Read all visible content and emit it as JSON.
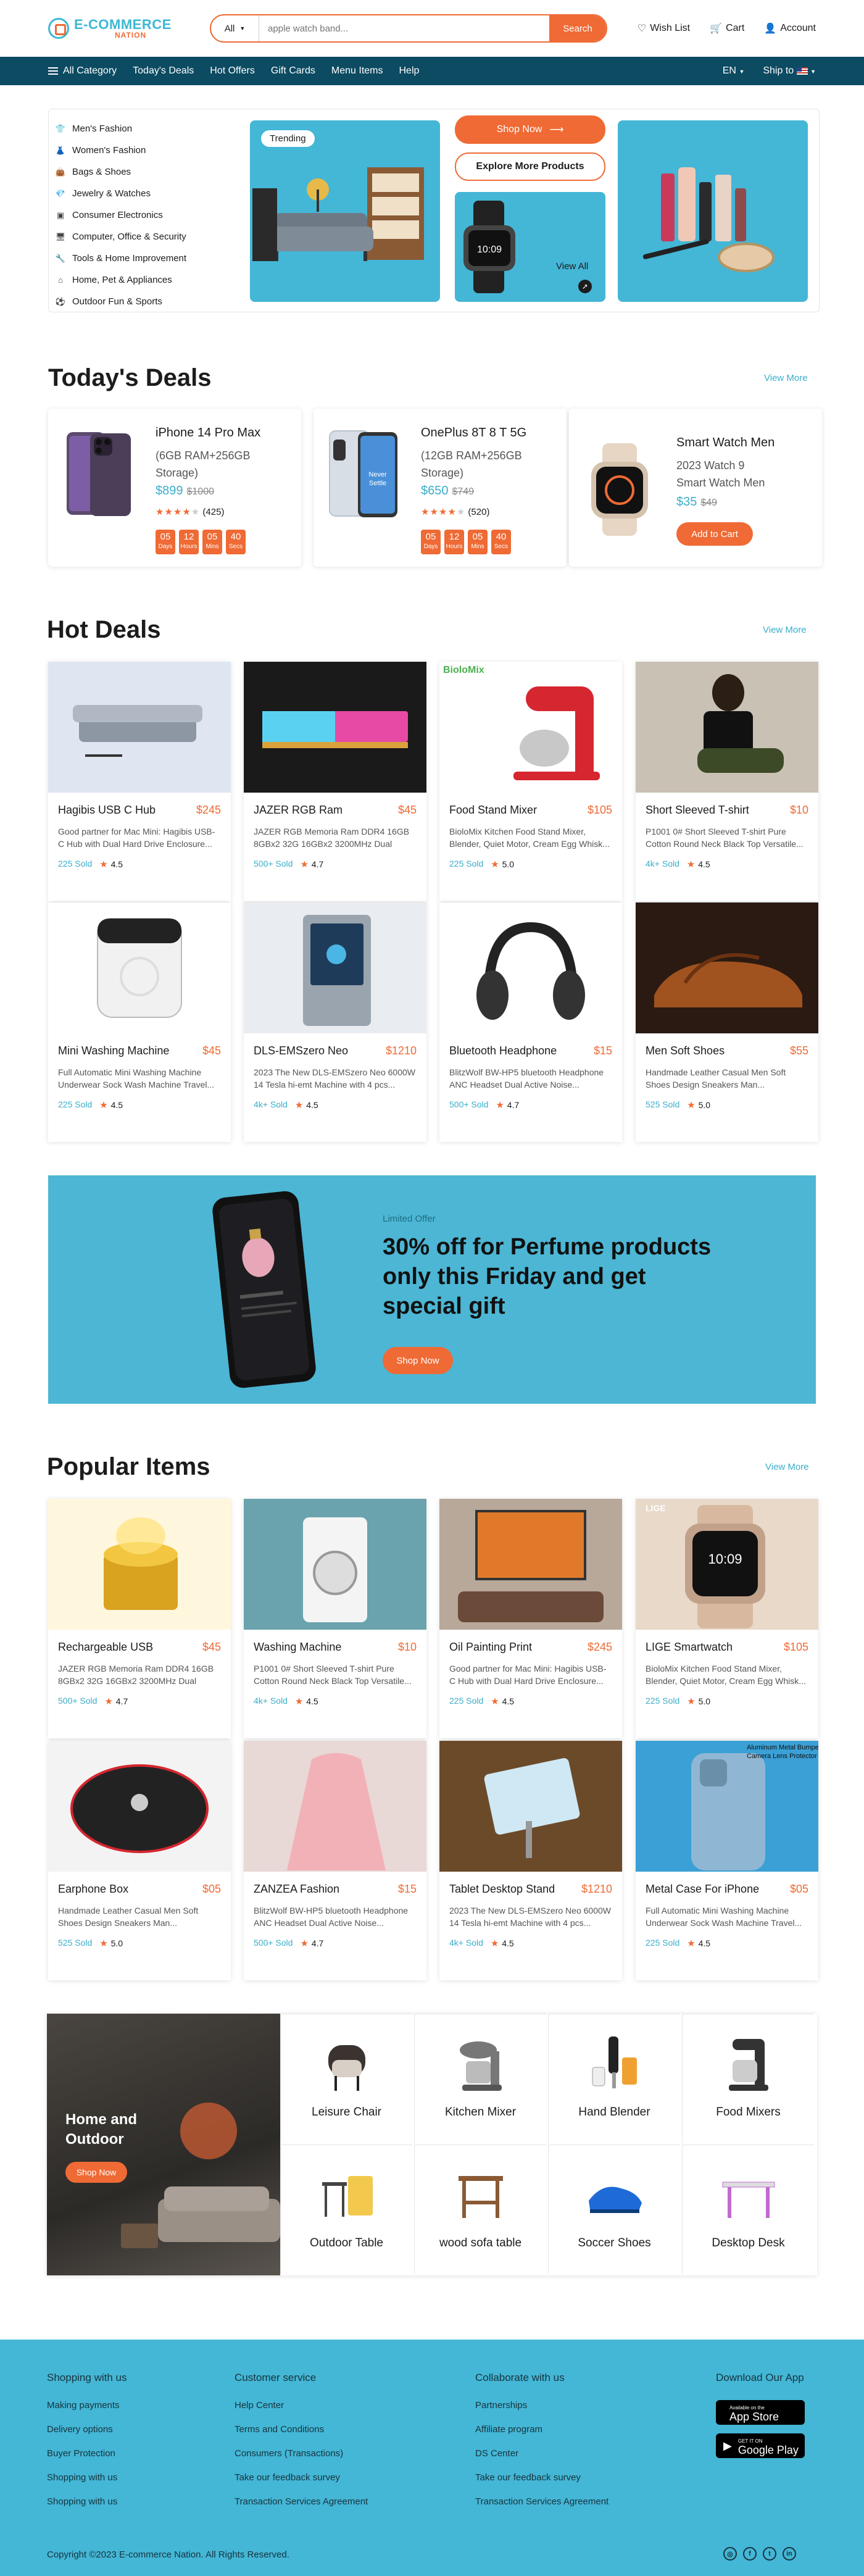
{
  "brand": {
    "line1": "E-COMMERCE",
    "line2": "NATION"
  },
  "search": {
    "category": "All",
    "placeholder": "apple watch band...",
    "button": "Search"
  },
  "header_links": [
    "Wish List",
    "Cart",
    "Account"
  ],
  "nav": {
    "all_category": "All Category",
    "items": [
      "Today's Deals",
      "Hot Offers",
      "Gift Cards",
      "Menu Items",
      "Help"
    ],
    "language": "EN",
    "ship_to": "Ship to"
  },
  "sidebar": {
    "items": [
      "Men's Fashion",
      "Women's Fashion",
      "Bags & Shoes",
      "Jewelry & Watches",
      "Consumer Electronics",
      "Computer, Office & Security",
      "Tools & Home Improvement",
      "Home, Pet & Appliances",
      "Outdoor Fun & Sports"
    ]
  },
  "hero": {
    "trending": "Trending",
    "shop_now": "Shop Now",
    "explore": "Explore More Products",
    "view_all": "View All"
  },
  "todays_deals": {
    "title": "Today's Deals",
    "view_more": "View More",
    "items": [
      {
        "name": "iPhone 14 Pro Max",
        "spec1": "(6GB RAM+256GB",
        "spec2": "Storage)",
        "price": "$899",
        "old": "$1000",
        "reviews": "(425)",
        "timer": [
          "05",
          "12",
          "05",
          "40"
        ]
      },
      {
        "name": "OnePlus 8T 8 T 5G",
        "spec1": "(12GB RAM+256GB",
        "spec2": "Storage)",
        "price": "$650",
        "old": "$749",
        "reviews": "(520)",
        "timer": [
          "05",
          "12",
          "05",
          "40"
        ]
      },
      {
        "name": "Smart Watch Men",
        "spec1": "2023 Watch 9",
        "spec2": "Smart Watch Men",
        "price": "$35",
        "old": "$49",
        "button": "Add to Cart"
      }
    ],
    "timer_labels": [
      "Days",
      "Hours",
      "Mins",
      "Secs"
    ],
    "rating": 4
  },
  "hot_deals": {
    "title": "Hot Deals",
    "view_more": "View More",
    "items": [
      {
        "name": "Hagibis USB C Hub",
        "price": "$245",
        "desc": "Good partner for Mac Mini: Hagibis USB-C Hub with Dual Hard Drive Enclosure...",
        "sold": "225 Sold",
        "rating": "4.5"
      },
      {
        "name": "JAZER RGB Ram",
        "price": "$45",
        "desc": "JAZER RGB Memoria Ram DDR4 16GB 8GBx2 32G 16GBx2 3200MHz Dual Cha...",
        "sold": "500+ Sold",
        "rating": "4.7"
      },
      {
        "name": "Food Stand Mixer",
        "price": "$105",
        "desc": "BioloMix Kitchen Food Stand Mixer, Blender, Quiet Motor, Cream Egg Whisk...",
        "sold": "225 Sold",
        "rating": "5.0"
      },
      {
        "name": "Short Sleeved T-shirt",
        "price": "$10",
        "desc": "P1001 0# Short Sleeved T-shirt Pure Cotton Round Neck Black Top Versatile...",
        "sold": "4k+ Sold",
        "rating": "4.5"
      },
      {
        "name": "Mini Washing Machine",
        "price": "$45",
        "desc": "Full Automatic Mini Washing Machine Underwear Sock Wash Machine Travel...",
        "sold": "225 Sold",
        "rating": "4.5"
      },
      {
        "name": "DLS-EMSzero Neo",
        "price": "$1210",
        "desc": "2023 The New DLS-EMSzero Neo 6000W 14 Tesla hi-emt Machine with 4 pcs...",
        "sold": "4k+ Sold",
        "rating": "4.5"
      },
      {
        "name": "Bluetooth Headphone",
        "price": "$15",
        "desc": "BlitzWolf BW-HP5 bluetooth Headphone ANC Headset Dual Active Noise...",
        "sold": "500+ Sold",
        "rating": "4.7"
      },
      {
        "name": "Men Soft Shoes",
        "price": "$55",
        "desc": "Handmade Leather Casual Men Soft Shoes Design Sneakers Man...",
        "sold": "525 Sold",
        "rating": "5.0"
      }
    ]
  },
  "banner": {
    "tag": "Limited Offer",
    "title": "30% off for Perfume products only this Friday and get special gift",
    "button": "Shop Now"
  },
  "popular": {
    "title": "Popular Items",
    "view_more": "View More",
    "items": [
      {
        "name": "Rechargeable USB",
        "price": "$45",
        "desc": "JAZER RGB Memoria Ram DDR4 16GB 8GBx2 32G 16GBx2 3200MHz Dual Cha...",
        "sold": "500+ Sold",
        "rating": "4.7"
      },
      {
        "name": "Washing Machine",
        "price": "$10",
        "desc": "P1001 0# Short Sleeved T-shirt Pure Cotton Round Neck Black Top Versatile...",
        "sold": "4k+ Sold",
        "rating": "4.5"
      },
      {
        "name": "Oil Painting Print",
        "price": "$245",
        "desc": "Good partner for Mac Mini: Hagibis USB-C Hub with Dual Hard Drive Enclosure...",
        "sold": "225 Sold",
        "rating": "4.5"
      },
      {
        "name": "LIGE Smartwatch",
        "price": "$105",
        "desc": "BioloMix Kitchen Food Stand Mixer, Blender, Quiet Motor, Cream Egg Whisk...",
        "sold": "225 Sold",
        "rating": "5.0"
      },
      {
        "name": "Earphone Box",
        "price": "$05",
        "desc": "Handmade Leather Casual Men Soft Shoes Design Sneakers Man...",
        "sold": "525 Sold",
        "rating": "5.0"
      },
      {
        "name": "ZANZEA Fashion",
        "price": "$15",
        "desc": "BlitzWolf BW-HP5 bluetooth Headphone ANC Headset Dual Active Noise...",
        "sold": "500+ Sold",
        "rating": "4.7"
      },
      {
        "name": "Tablet Desktop Stand",
        "price": "$1210",
        "desc": "2023 The New DLS-EMSzero Neo 6000W 14 Tesla hi-emt Machine with 4 pcs...",
        "sold": "4k+ Sold",
        "rating": "4.5"
      },
      {
        "name": "Metal Case For iPhone",
        "price": "$05",
        "desc": "Full Automatic Mini Washing Machine Underwear Sock Wash Machine Travel...",
        "sold": "225 Sold",
        "rating": "4.5"
      }
    ]
  },
  "home_outdoor": {
    "title": "Home and Outdoor",
    "button": "Shop Now",
    "items": [
      "Leisure Chair",
      "Kitchen Mixer",
      "Hand Blender",
      "Food Mixers",
      "Outdoor Table",
      "wood sofa table",
      "Soccer Shoes",
      "Desktop Desk"
    ]
  },
  "footer": {
    "col1": {
      "title": "Shopping with us",
      "items": [
        "Making payments",
        "Delivery options",
        "Buyer Protection",
        "Shopping with us",
        "Shopping with us"
      ]
    },
    "col2": {
      "title": "Customer service",
      "items": [
        "Help Center",
        "Terms and Conditions",
        "Consumers (Transactions)",
        "Take our feedback survey",
        "Transaction Services Agreement"
      ]
    },
    "col3": {
      "title": "Collaborate with us",
      "items": [
        "Partnerships",
        "Affiliate program",
        "DS Center",
        "Take our feedback survey",
        "Transaction Services Agreement"
      ]
    },
    "download": {
      "title": "Download Our App",
      "appstore_small": "Available on the",
      "appstore": "App Store",
      "play_small": "GET IT ON",
      "play": "Google Play"
    },
    "copyright": "Copyright ©2023 E-commerce Nation. All Rights Reserved."
  },
  "colors": {
    "primary": "#3db8d3",
    "accent": "#ef6a34",
    "nav": "#0c4b62"
  }
}
